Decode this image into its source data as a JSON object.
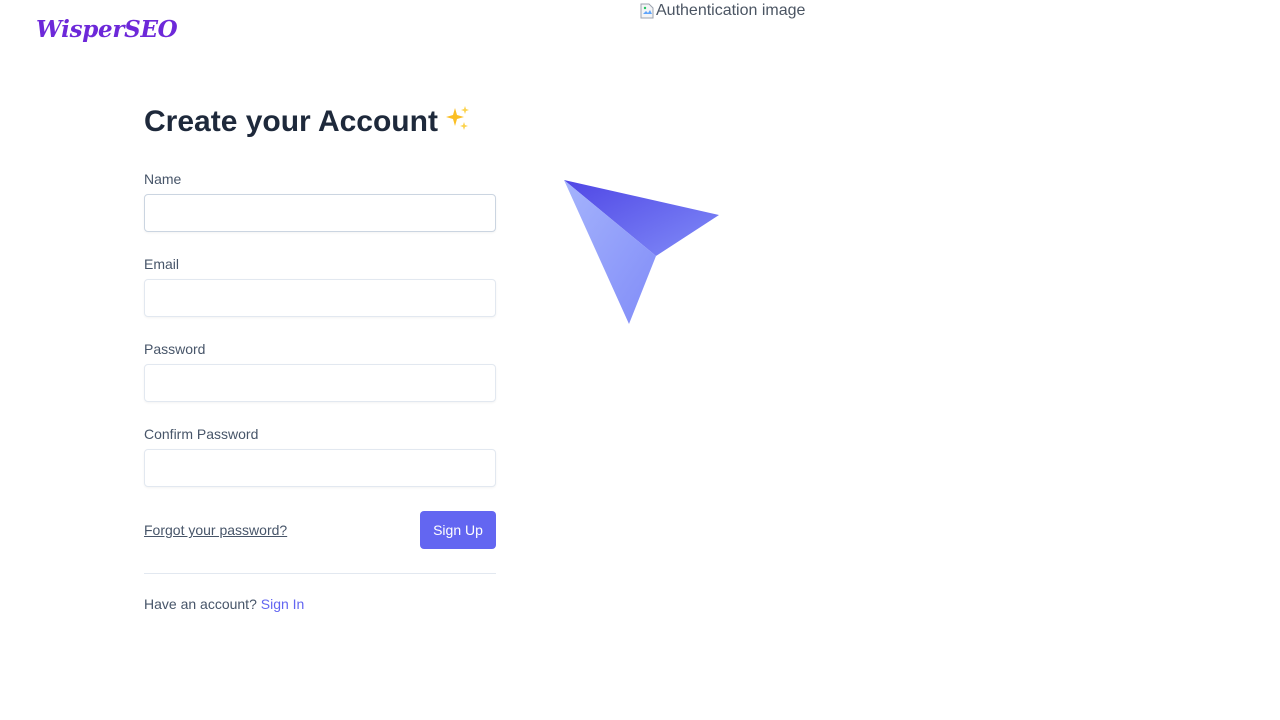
{
  "brand": {
    "logo_text": "WisperSEO",
    "logo_color": "#6d28d9"
  },
  "form": {
    "title": "Create your Account",
    "title_emoji": "sparkles-icon",
    "fields": [
      {
        "label": "Name",
        "value": "",
        "placeholder": ""
      },
      {
        "label": "Email",
        "value": "",
        "placeholder": ""
      },
      {
        "label": "Password",
        "value": "",
        "placeholder": ""
      },
      {
        "label": "Confirm Password",
        "value": "",
        "placeholder": ""
      }
    ],
    "forgot_link": "Forgot your password?",
    "submit_label": "Sign Up",
    "footer_text": "Have an account?",
    "signin_link": "Sign In"
  },
  "auth_image": {
    "alt_text": "Authentication image"
  },
  "colors": {
    "accent": "#6366f1",
    "title": "#1e293b",
    "muted": "#475569"
  }
}
